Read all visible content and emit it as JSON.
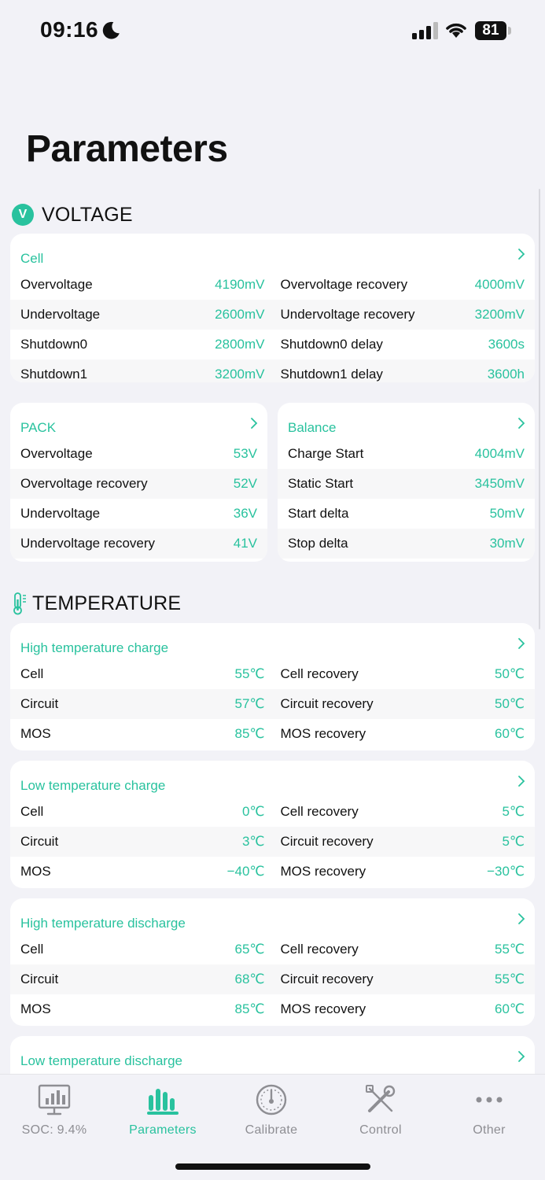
{
  "status": {
    "time": "09:16",
    "battery": "81"
  },
  "title": "Parameters",
  "sections": {
    "voltage": "VOLTAGE",
    "voltage_badge": "V",
    "temperature": "TEMPERATURE"
  },
  "cards": {
    "cell": {
      "title": "Cell",
      "rows": [
        {
          "l1": "Overvoltage",
          "v1": "4190mV",
          "l2": "Overvoltage recovery",
          "v2": "4000mV"
        },
        {
          "l1": "Undervoltage",
          "v1": "2600mV",
          "l2": "Undervoltage recovery",
          "v2": "3200mV"
        },
        {
          "l1": "Shutdown0",
          "v1": "2800mV",
          "l2": "Shutdown0 delay",
          "v2": "3600s"
        },
        {
          "l1": "Shutdown1",
          "v1": "3200mV",
          "l2": "Shutdown1 delay",
          "v2": "3600h"
        }
      ]
    },
    "pack": {
      "title": "PACK",
      "rows": [
        {
          "l": "Overvoltage",
          "v": "53V"
        },
        {
          "l": "Overvoltage recovery",
          "v": "52V"
        },
        {
          "l": "Undervoltage",
          "v": "36V"
        },
        {
          "l": "Undervoltage recovery",
          "v": "41V"
        }
      ]
    },
    "balance": {
      "title": "Balance",
      "rows": [
        {
          "l": "Charge Start",
          "v": "4004mV"
        },
        {
          "l": "Static Start",
          "v": "3450mV"
        },
        {
          "l": "Start delta",
          "v": "50mV"
        },
        {
          "l": "Stop delta",
          "v": "30mV"
        }
      ]
    },
    "htc": {
      "title": "High temperature charge",
      "rows": [
        {
          "l1": "Cell",
          "v1": "55℃",
          "l2": "Cell recovery",
          "v2": "50℃"
        },
        {
          "l1": "Circuit",
          "v1": "57℃",
          "l2": "Circuit recovery",
          "v2": "50℃"
        },
        {
          "l1": "MOS",
          "v1": "85℃",
          "l2": "MOS recovery",
          "v2": "60℃"
        }
      ]
    },
    "ltc": {
      "title": "Low temperature charge",
      "rows": [
        {
          "l1": "Cell",
          "v1": "0℃",
          "l2": "Cell recovery",
          "v2": "5℃"
        },
        {
          "l1": "Circuit",
          "v1": "3℃",
          "l2": "Circuit recovery",
          "v2": "5℃"
        },
        {
          "l1": "MOS",
          "v1": "−40℃",
          "l2": "MOS recovery",
          "v2": "−30℃"
        }
      ]
    },
    "htd": {
      "title": "High temperature discharge",
      "rows": [
        {
          "l1": "Cell",
          "v1": "65℃",
          "l2": "Cell recovery",
          "v2": "55℃"
        },
        {
          "l1": "Circuit",
          "v1": "68℃",
          "l2": "Circuit recovery",
          "v2": "55℃"
        },
        {
          "l1": "MOS",
          "v1": "85℃",
          "l2": "MOS recovery",
          "v2": "60℃"
        }
      ]
    },
    "ltd": {
      "title": "Low temperature discharge"
    }
  },
  "tabs": {
    "soc": "SOC: 9.4%",
    "parameters": "Parameters",
    "calibrate": "Calibrate",
    "control": "Control",
    "other": "Other"
  },
  "colors": {
    "accent": "#29c29e",
    "inactive": "#8e8e93"
  }
}
